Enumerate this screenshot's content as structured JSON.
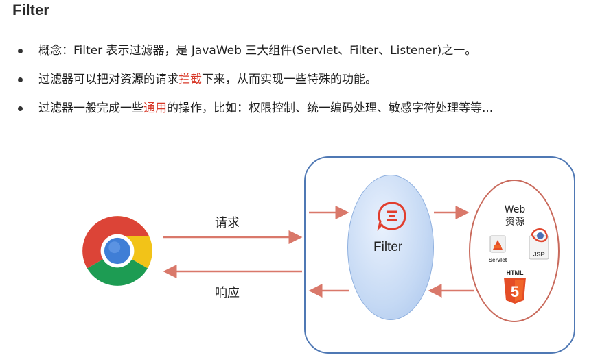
{
  "title": "Filter",
  "bullets": [
    {
      "text": "概念：Filter 表示过滤器，是 JavaWeb 三大组件(Servlet、Filter、Listener)之一。"
    },
    {
      "before": "过滤器可以把对资源的请求",
      "highlight": "拦截",
      "after": "下来，从而实现一些特殊的功能。"
    },
    {
      "before": "过滤器一般完成一些",
      "highlight": "通用",
      "after": "的操作，比如：权限控制、统一编码处理、敏感字符处理等等..."
    }
  ],
  "diagram": {
    "request_label": "请求",
    "response_label": "响应",
    "filter_label": "Filter",
    "web_resource_title_line1": "Web",
    "web_resource_title_line2": "资源",
    "servlet_label": "Servlet",
    "jsp_label": "JSP",
    "html_label": "HTML",
    "html_badge": "5"
  },
  "colors": {
    "arrow": "#d9786a",
    "highlight": "#d83a2a",
    "server_border": "#4f78b4",
    "web_oval_border": "#c96a5c"
  }
}
